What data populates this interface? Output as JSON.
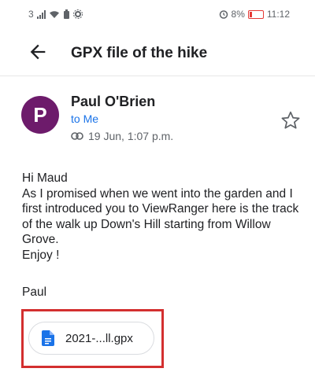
{
  "status_bar": {
    "left_text": "3",
    "right_text": "8%",
    "time": "11:12"
  },
  "appbar": {
    "back_icon": "arrow-left-icon",
    "title": "GPX file of the hike"
  },
  "email": {
    "avatar_letter": "P",
    "avatar_color": "#6d1b6b",
    "sender": "Paul O'Brien",
    "to_label": "to Me",
    "date": "19 Jun, 1:07 p.m.",
    "body_lines": [
      "Hi Maud",
      "As I promised when we went into the garden and I first introduced you to ViewRanger here is the track of the walk up Down's Hill starting from Willow Grove.",
      "Enjoy !"
    ],
    "signature": "Paul",
    "attachment": {
      "label": "2021-...ll.gpx",
      "icon": "document-icon",
      "icon_color": "#1a73e8"
    }
  }
}
